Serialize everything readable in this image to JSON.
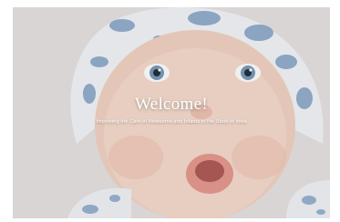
{
  "hero": {
    "headline": "Welcome!",
    "tagline": "Improving the Care of Newborns and Infants in the State of Iowa",
    "image": "baby-photo",
    "colors": {
      "overlay_text": "#ffffff",
      "hat_print": "#7fa0c4",
      "background": "#e6e2e1"
    }
  }
}
